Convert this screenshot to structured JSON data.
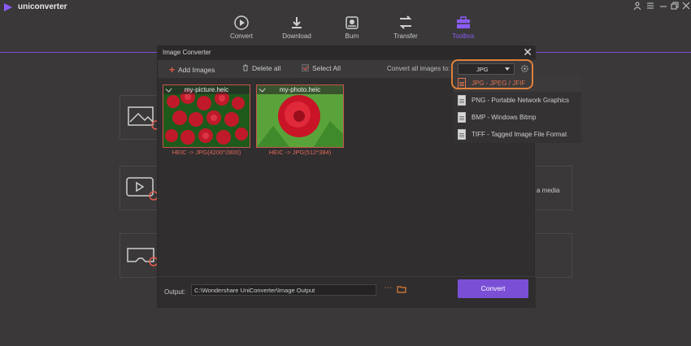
{
  "app": {
    "title": "uniconverter"
  },
  "window_controls": [
    "user-icon",
    "menu-icon",
    "minimize-icon",
    "restore-icon",
    "close-icon"
  ],
  "nav": {
    "items": [
      {
        "label": "Convert",
        "icon": "convert-icon"
      },
      {
        "label": "Download",
        "icon": "download-icon"
      },
      {
        "label": "Burn",
        "icon": "burn-icon"
      },
      {
        "label": "Transfer",
        "icon": "transfer-icon"
      },
      {
        "label": "Toolbox",
        "icon": "toolbox-icon",
        "active": true
      }
    ]
  },
  "background": {
    "partial_text": "a media"
  },
  "modal": {
    "title": "Image Converter",
    "toolbar": {
      "add_images": "Add Images",
      "delete_all": "Delete all",
      "select_all": "Select All",
      "convert_all_label": "Convert all images to:",
      "selected_format": "JPG"
    },
    "images": [
      {
        "name": "my-picture.heic",
        "caption": "HEIC -> JPG(4200*2800)",
        "checked": true
      },
      {
        "name": "my-photo.heic",
        "caption": "HEIC -> JPG(512*384)",
        "checked": true
      }
    ],
    "output": {
      "label": "Output:",
      "path": "C:\\Wondershare UniConverter\\Image Output",
      "more": "⋯",
      "convert_button": "Convert"
    }
  },
  "format_dropdown": {
    "options": [
      {
        "label": "JPG - JPEG / JFIF",
        "selected": true
      },
      {
        "label": "PNG - Portable Network Graphics"
      },
      {
        "label": "BMP - Windows Bitmp"
      },
      {
        "label": "TIFF - Tagged Image File Format"
      }
    ]
  },
  "colors": {
    "accent": "#7a4fd6",
    "highlight": "#e0813a",
    "selection": "#e0734f"
  }
}
